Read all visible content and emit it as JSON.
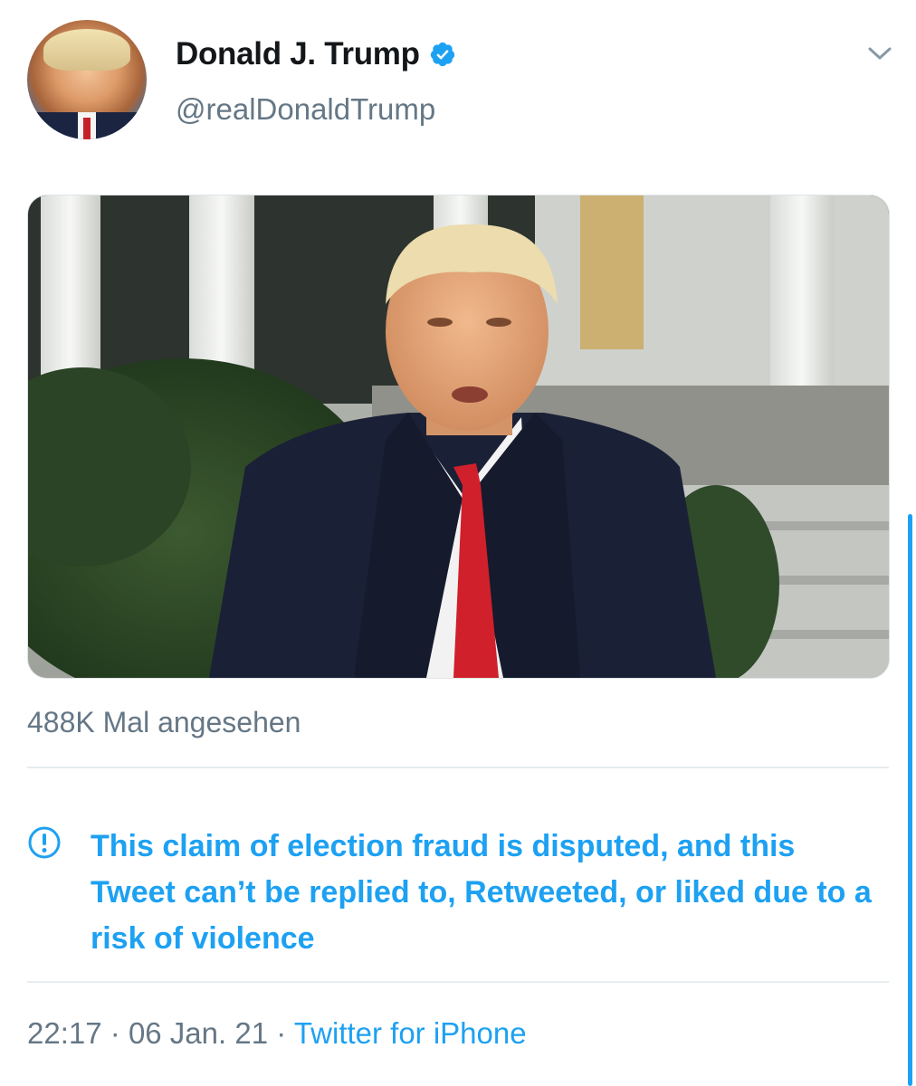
{
  "tweet": {
    "author": {
      "display_name": "Donald J. Trump",
      "handle": "@realDonaldTrump",
      "verified": true
    },
    "media": {
      "type": "video"
    },
    "view_count": "488K Mal angesehen",
    "notice": {
      "icon": "exclamation-circle-icon",
      "text": "This claim of election fraud is disputed, and this Tweet can’t be replied to, Retweeted, or liked due to a risk of violence"
    },
    "meta": {
      "time": "22:17",
      "separator": "·",
      "date": "06 Jan. 21",
      "source": "Twitter for iPhone"
    }
  },
  "colors": {
    "accent": "#1da1f2",
    "secondary_text": "#657786",
    "primary_text": "#14171a",
    "divider": "#e6ecf0"
  },
  "icons": {
    "verified": "verified-badge-icon",
    "menu": "chevron-down-icon"
  }
}
